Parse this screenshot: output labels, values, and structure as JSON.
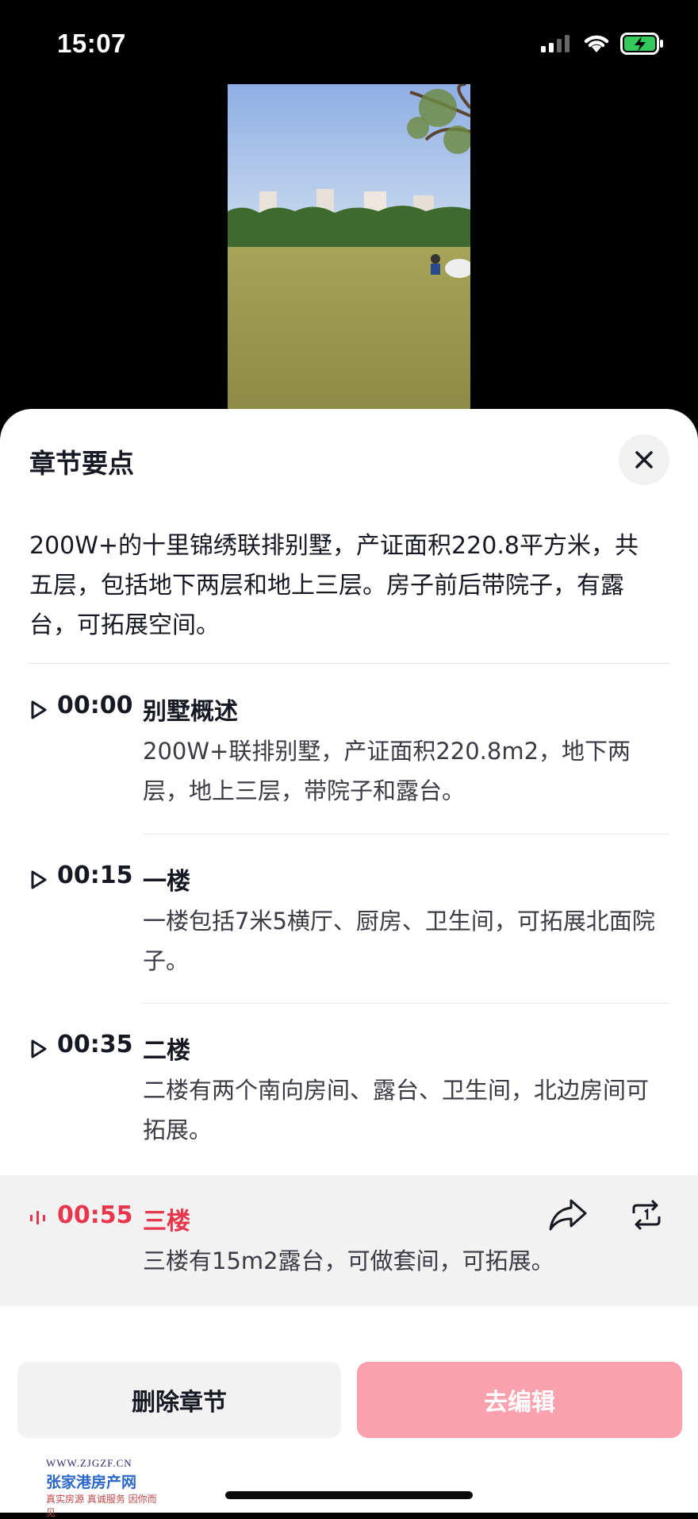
{
  "status_bar": {
    "time": "15:07"
  },
  "sheet": {
    "title": "章节要点",
    "summary": "200W+的十里锦绣联排别墅，产证面积220.8平方米，共五层，包括地下两层和地上三层。房子前后带院子，有露台，可拓展空间。"
  },
  "chapters": [
    {
      "time": "00:00",
      "title": "别墅概述",
      "desc": "200W+联排别墅，产证面积220.8m2，地下两层，地上三层，带院子和露台。",
      "icon": "play-icon"
    },
    {
      "time": "00:15",
      "title": "一楼",
      "desc": "一楼包括7米5横厅、厨房、卫生间，可拓展北面院子。",
      "icon": "play-icon"
    },
    {
      "time": "00:35",
      "title": "二楼",
      "desc": "二楼有两个南向房间、露台、卫生间，北边房间可拓展。",
      "icon": "play-icon"
    },
    {
      "time": "00:55",
      "title": "三楼",
      "desc": "三楼有15m2露台，可做套间，可拓展。",
      "icon": "playing-bars-icon",
      "active": true
    }
  ],
  "buttons": {
    "delete": "删除章节",
    "edit": "去编辑"
  },
  "watermark": {
    "line1": "WWW.ZJGZF.CN",
    "line2": "张家港房产网",
    "line3": "真实房源 真诚服务 因你而见"
  },
  "colors": {
    "accent": "#e8364d",
    "edit_button": "#fba1ad"
  }
}
